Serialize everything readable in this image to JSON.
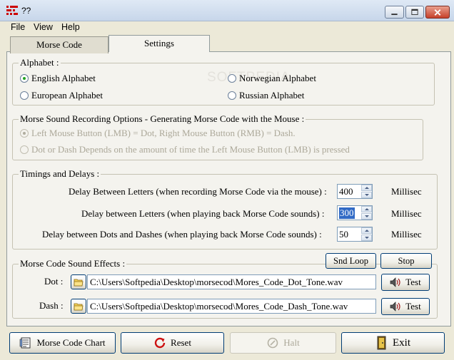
{
  "window": {
    "title": "??"
  },
  "menu": {
    "items": [
      "File",
      "View",
      "Help"
    ]
  },
  "tabs": [
    {
      "label": "Morse Code",
      "active": false
    },
    {
      "label": "Settings",
      "active": true
    }
  ],
  "watermark": "SOFTPEDIA",
  "alphabet": {
    "legend": "Alphabet :",
    "options": [
      {
        "label": "English Alphabet",
        "checked": true
      },
      {
        "label": "Norwegian Alphabet",
        "checked": false
      },
      {
        "label": "European Alphabet",
        "checked": false
      },
      {
        "label": "Russian Alphabet",
        "checked": false
      }
    ]
  },
  "recording": {
    "legend": "Morse Sound Recording Options - Generating Morse Code with the Mouse :",
    "options": [
      {
        "label": "Left Mouse Button (LMB) = Dot, Right Mouse Button (RMB) = Dash.",
        "checked": true,
        "enabled": false
      },
      {
        "label": "Dot or Dash Depends on the amount of time the Left Mouse Button (LMB)  is pressed",
        "checked": false,
        "enabled": false
      }
    ]
  },
  "timings": {
    "legend": "Timings and Delays :",
    "rows": [
      {
        "label": "Delay Between Letters (when recording Morse Code via the mouse) :",
        "value": "400",
        "unit": "Millisec"
      },
      {
        "label": "Delay between Letters (when playing back Morse Code sounds) :",
        "value": "300",
        "unit": "Millisec"
      },
      {
        "label": "Delay between Dots and Dashes (when playing back Morse Code sounds) :",
        "value": "50",
        "unit": "Millisec"
      }
    ]
  },
  "sound": {
    "legend": "Morse Code Sound Effects :",
    "snd_loop_label": "Snd Loop",
    "stop_label": "Stop",
    "dot_label": "Dot :",
    "dot_path": "C:\\Users\\Softpedia\\Desktop\\morsecod\\Mores_Code_Dot_Tone.wav",
    "dash_label": "Dash :",
    "dash_path": "C:\\Users\\Softpedia\\Desktop\\morsecod\\Mores_Code_Dash_Tone.wav",
    "test_label": "Test"
  },
  "bottom_buttons": {
    "chart": "Morse Code Chart",
    "reset": "Reset",
    "halt": "Halt",
    "exit": "Exit"
  },
  "colors": {
    "accent": "#21a121",
    "selection": "#316ac5",
    "reset_icon": "#cc1111"
  }
}
